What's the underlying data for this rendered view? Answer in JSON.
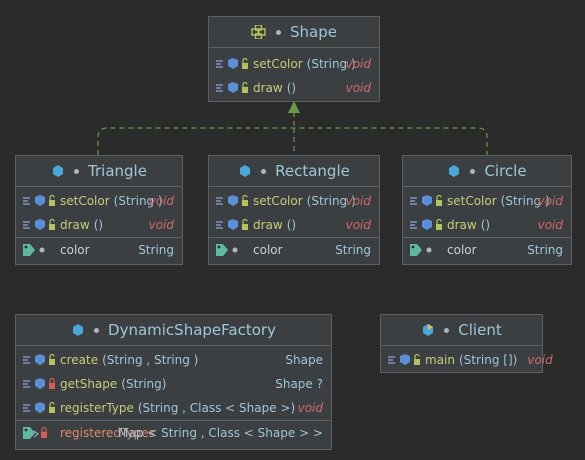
{
  "shape": {
    "title": "Shape",
    "methods": [
      {
        "name": "setColor",
        "params": "(String )",
        "ret": "void"
      },
      {
        "name": "draw",
        "params": "()",
        "ret": "void"
      }
    ]
  },
  "triangle": {
    "title": "Triangle",
    "methods": [
      {
        "name": "setColor",
        "params": "(String )",
        "ret": "void"
      },
      {
        "name": "draw",
        "params": "()",
        "ret": "void"
      }
    ],
    "field": {
      "name": "color",
      "type": "String"
    }
  },
  "rectangle": {
    "title": "Rectangle",
    "methods": [
      {
        "name": "setColor",
        "params": "(String )",
        "ret": "void"
      },
      {
        "name": "draw",
        "params": "()",
        "ret": "void"
      }
    ],
    "field": {
      "name": "color",
      "type": "String"
    }
  },
  "circle": {
    "title": "Circle",
    "methods": [
      {
        "name": "setColor",
        "params": "(String )",
        "ret": "void"
      },
      {
        "name": "draw",
        "params": "()",
        "ret": "void"
      }
    ],
    "field": {
      "name": "color",
      "type": "String"
    }
  },
  "factory": {
    "title": "DynamicShapeFactory",
    "methods": [
      {
        "name": "create",
        "params": "(String , String )",
        "ret": "Shape"
      },
      {
        "name": "getShape",
        "params": "(String)",
        "ret": "Shape ?"
      },
      {
        "name": "registerType",
        "params": "(String , Class < Shape >)",
        "ret": "void"
      }
    ],
    "field": {
      "name": "registeredTypes",
      "type": "Map < String , Class < Shape > >"
    }
  },
  "client": {
    "title": "Client",
    "methods": [
      {
        "name": "main",
        "params": "(String [])",
        "ret": "void"
      }
    ]
  },
  "colors": {
    "background": "#2b2b2b",
    "box": "#3c3f41",
    "title": "#9ec6d9",
    "method": "#c5cd7a",
    "void": "#cf6a6a",
    "arrow": "#6a9a4a"
  }
}
